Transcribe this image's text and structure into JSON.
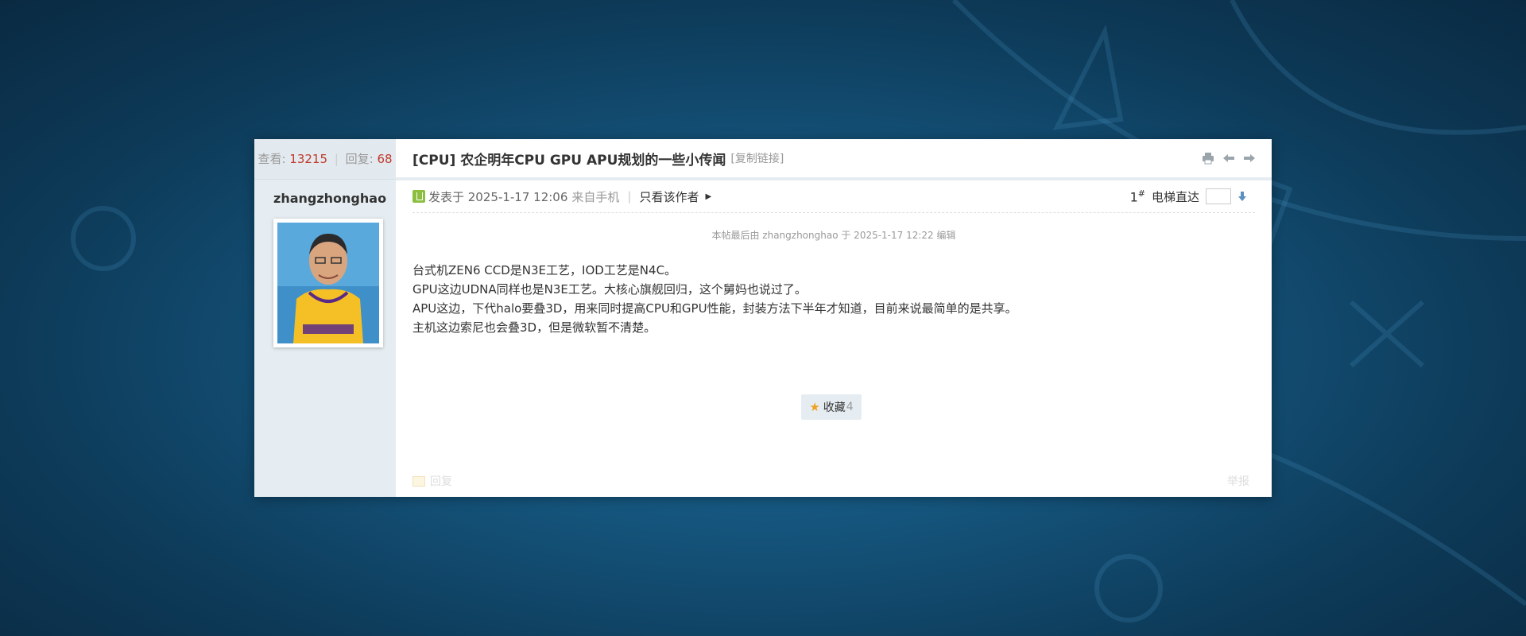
{
  "thread": {
    "stats": {
      "views_label": "查看:",
      "views": "13215",
      "sep": "|",
      "replies_label": "回复:",
      "replies": "68"
    },
    "title": "[CPU] 农企明年CPU GPU APU规划的一些小传闻",
    "copy_link": "[复制链接]",
    "icons": [
      "print-icon",
      "prev-thread-icon",
      "next-thread-icon"
    ]
  },
  "post": {
    "author": "zhangzhonghao",
    "posted_at": "发表于 2025-1-17 12:06",
    "from_mobile": "来自手机",
    "sep": "|",
    "only_author": "只看该作者",
    "floor_number": "1",
    "floor_mark": "#",
    "jump_label": "电梯直达",
    "edit_note": "本帖最后由 zhangzhonghao 于 2025-1-17 12:22 编辑",
    "lines": [
      "台式机ZEN6 CCD是N3E工艺，IOD工艺是N4C。",
      "GPU这边UDNA同样也是N3E工艺。大核心旗舰回归，这个舅妈也说过了。",
      "APU这边，下代halo要叠3D，用来同时提高CPU和GPU性能，封装方法下半年才知道，目前来说最简单的是共享。",
      "主机这边索尼也会叠3D，但是微软暂不清楚。"
    ],
    "favorite_label": "收藏",
    "favorite_count": "4",
    "reply_label": "回复",
    "report_label": "举报"
  },
  "colors": {
    "sidebar_bg": "#e5edf2",
    "accent_red": "#c0392b",
    "star": "#f0a020"
  }
}
